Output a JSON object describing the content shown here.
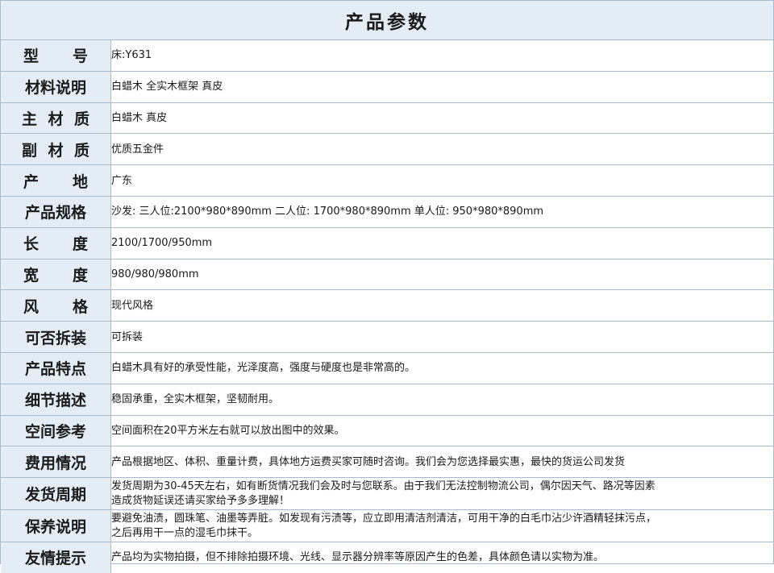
{
  "title": "产品参数",
  "rows": [
    {
      "label": "型号",
      "value": "床:Y631",
      "spread": 2
    },
    {
      "label": "材料说明",
      "value": "白蜡木 全实木框架 真皮",
      "spread": 0
    },
    {
      "label": "主材质",
      "value": "白蜡木 真皮",
      "spread": 3
    },
    {
      "label": "副材质",
      "value": "优质五金件",
      "spread": 3
    },
    {
      "label": "产地",
      "value": "广东",
      "spread": 2
    },
    {
      "label": "产品规格",
      "value": "沙发: 三人位:2100*980*890mm 二人位: 1700*980*890mm 单人位: 950*980*890mm",
      "spread": 0
    },
    {
      "label": "长度",
      "value": "2100/1700/950mm",
      "spread": 2
    },
    {
      "label": "宽度",
      "value": "980/980/980mm",
      "spread": 2
    },
    {
      "label": "风格",
      "value": "现代风格",
      "spread": 2
    },
    {
      "label": "可否拆装",
      "value": "可拆装",
      "spread": 0
    },
    {
      "label": "产品特点",
      "value": "白蜡木具有好的承受性能，光泽度高，强度与硬度也是非常高的。",
      "spread": 0
    },
    {
      "label": "细节描述",
      "value": "稳固承重，全实木框架，坚韧耐用。",
      "spread": 0
    },
    {
      "label": "空间参考",
      "value": "空间面积在20平方米左右就可以放出图中的效果。",
      "spread": 0
    },
    {
      "label": "费用情况",
      "value": "产品根据地区、体积、重量计费，具体地方运费买家可随时咨询。我们会为您选择最实惠，最快的货运公司发货",
      "spread": 0
    },
    {
      "label": "发货周期",
      "value": "发货周期为30-45天左右，如有断货情况我们会及时与您联系。由于我们无法控制物流公司，偶尔因天气、路况等因素",
      "value2": "造成货物延误还请买家给予多多理解！",
      "spread": 0
    },
    {
      "label": "保养说明",
      "value": "要避免油渍，圆珠笔、油墨等弄脏。如发现有污渍等，应立即用清洁剂清洁，可用干净的白毛巾沾少许酒精轻抹污点，",
      "value2": "之后再用干一点的湿毛巾抹干。",
      "spread": 0
    },
    {
      "label": "友情提示",
      "value": "产品均为实物拍摄，但不排除拍摄环境、光线、显示器分辨率等原因产生的色差，具体颜色请以实物为准。",
      "spread": 0
    }
  ]
}
